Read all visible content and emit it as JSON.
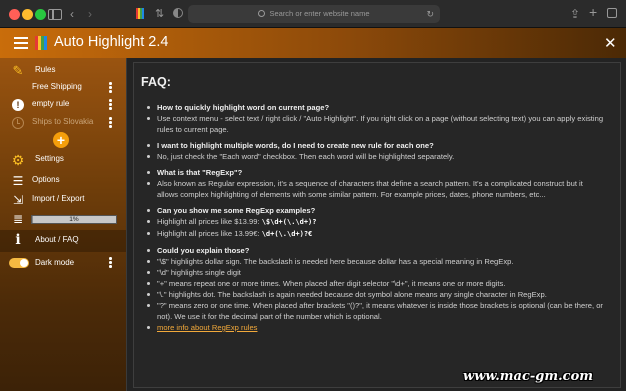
{
  "browser": {
    "url_placeholder": "Search or enter website name"
  },
  "header": {
    "title": "Auto Highlight 2.4",
    "close_label": "✕"
  },
  "sidebar": {
    "rules_label": "Rules",
    "rules": [
      {
        "label": "Free Shipping",
        "icon": "none"
      },
      {
        "label": "empty rule",
        "icon": "exclamation-icon"
      },
      {
        "label": "Ships to Slovakia",
        "icon": "clock-icon"
      }
    ],
    "add_label": "+",
    "settings_label": "Settings",
    "options_label": "Options",
    "import_export_label": "Import / Export",
    "storage_text": "1%",
    "storage_fraction": 0.01,
    "about_label": "About / FAQ",
    "dark_mode_label": "Dark mode",
    "dark_mode_on": true,
    "colors": {
      "accent": "#f59e0b",
      "header_start": "#c96d0b",
      "header_end": "#4b2905"
    }
  },
  "faq": {
    "title": "FAQ:",
    "q1": "How to quickly highlight word on current page?",
    "a1": "Use context menu - select text / right click / \"Auto Highlight\". If you right click on a page (without selecting text) you can apply existing rules to current page.",
    "q2": "I want to highlight multiple words, do I need to create new rule for each one?",
    "a2": "No, just check the \"Each word\" checkbox. Then each word will be highlighted separately.",
    "q3": "What is that \"RegExp\"?",
    "a3": "Also known as Regular expression, it's a sequence of characters that define a search pattern. It's a complicated construct but it allows complex highlighting of elements with some similar pattern. For example prices, dates, phone numbers, etc...",
    "q4": "Can you show me some RegExp examples?",
    "ex1_text": "Highlight all prices like $13.99:",
    "ex1_code": "\\$\\d+(\\.\\d+)?",
    "ex2_text": "Highlight all prices like 13.99€:",
    "ex2_code": "\\d+(\\.\\d+)?€",
    "q5": "Could you explain those?",
    "e1": "\"\\$\" highlights dollar sign. The backslash is needed here because dollar has a special meaning in RegExp.",
    "e2": "\"\\d\" highlights single digit",
    "e3": "\"+\" means repeat one or more times. When placed after digit selector \"\\d+\", it means one or more digits.",
    "e4": "\"\\.\" highlights dot. The backslash is again needed because dot symbol alone means any single character in RegExp.",
    "e5": "\"?\" means zero or one time. When placed after brackets \"()?\", it means whatever is inside those brackets is optional (can be there, or not). We use it for the decimal part of the number which is optional.",
    "link": "more info about RegExp rules"
  },
  "watermark": "www.mac-gm.com"
}
